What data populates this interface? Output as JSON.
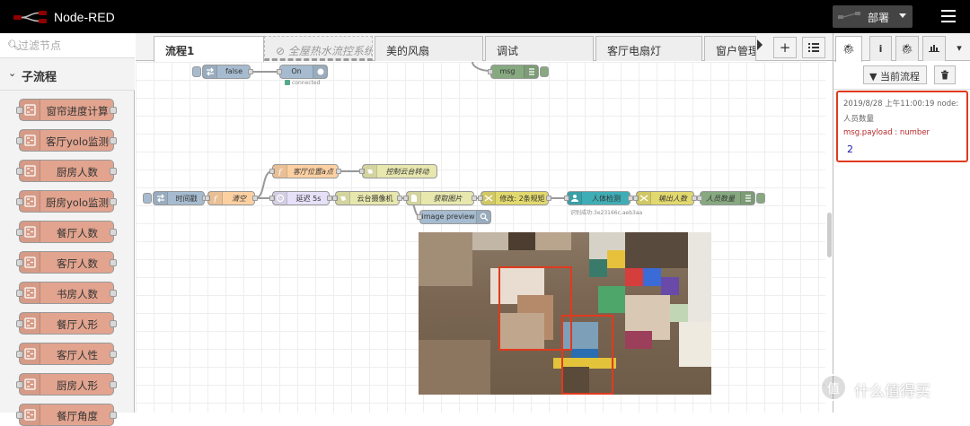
{
  "header": {
    "title": "Node-RED",
    "deploy_label": "部署"
  },
  "palette": {
    "filter_placeholder": "过滤节点",
    "category": "子流程",
    "nodes": [
      "窗帘进度计算",
      "客厅yolo监测",
      "厨房人数",
      "厨房yolo监测",
      "餐厅人数",
      "客厅人数",
      "书房人数",
      "餐厅人形",
      "客厅人性",
      "厨房人形",
      "餐厅角度"
    ]
  },
  "tabs": [
    "流程1",
    "全屋热水流控系统",
    "美的风扇",
    "调试",
    "客厅电扇灯",
    "窗户管理"
  ],
  "workspace": {
    "nodes": {
      "false": "false",
      "on": "On",
      "on_status": "connected",
      "msg": "msg",
      "timestamp": "时间戳",
      "clear": "清空",
      "living_pos": "客厅位置a点",
      "ptz": "控制云台转动",
      "delay": "延迟 5s",
      "camera": "云台摄像机",
      "getimg": "获取图片",
      "modify": "修改: 2条规矩",
      "detect": "人体检测",
      "detect_status": "识别成功:3e23166c.aeb3aa",
      "output": "输出人数",
      "count": "人员数量",
      "preview": "image preview"
    }
  },
  "sidebar": {
    "current_flow": "当前流程",
    "message": {
      "meta": "2019/8/28 上午11:00:19   node:",
      "node": "人员数量",
      "prop": "msg.payload : number",
      "value": "2"
    }
  },
  "watermark": "什么值得买",
  "colors": {
    "header": "#000000",
    "subflow": "#e2a48f",
    "debug": "#87a980",
    "inject": "#a6bbcf",
    "function": "#fdd0a2",
    "highlight": "#e03a1e"
  }
}
